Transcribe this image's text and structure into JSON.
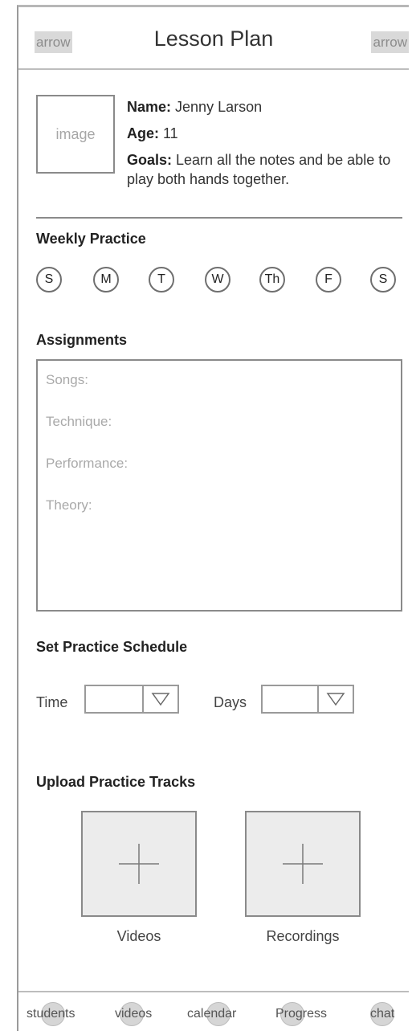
{
  "header": {
    "left_arrow": "arrow",
    "title": "Lesson Plan",
    "right_arrow": "arrow"
  },
  "profile": {
    "image_placeholder": "image",
    "name_label": "Name:",
    "name_value": " Jenny Larson",
    "age_label": "Age:",
    "age_value": " 11",
    "goals_label": "Goals:",
    "goals_value": " Learn all the notes and be able to play both hands together."
  },
  "weekly_practice": {
    "title": "Weekly Practice",
    "days": [
      "S",
      "M",
      "T",
      "W",
      "Th",
      "F",
      "S"
    ]
  },
  "assignments": {
    "title": "Assignments",
    "fields": [
      "Songs:",
      "Technique:",
      "Performance:",
      "Theory:"
    ]
  },
  "schedule": {
    "title": "Set Practice Schedule",
    "time_label": "Time",
    "days_label": "Days"
  },
  "upload": {
    "title": "Upload Practice Tracks",
    "videos_label": "Videos",
    "recordings_label": "Recordings"
  },
  "bottom_nav": {
    "items": [
      "students",
      "videos",
      "calendar",
      "Progress",
      "chat"
    ]
  }
}
